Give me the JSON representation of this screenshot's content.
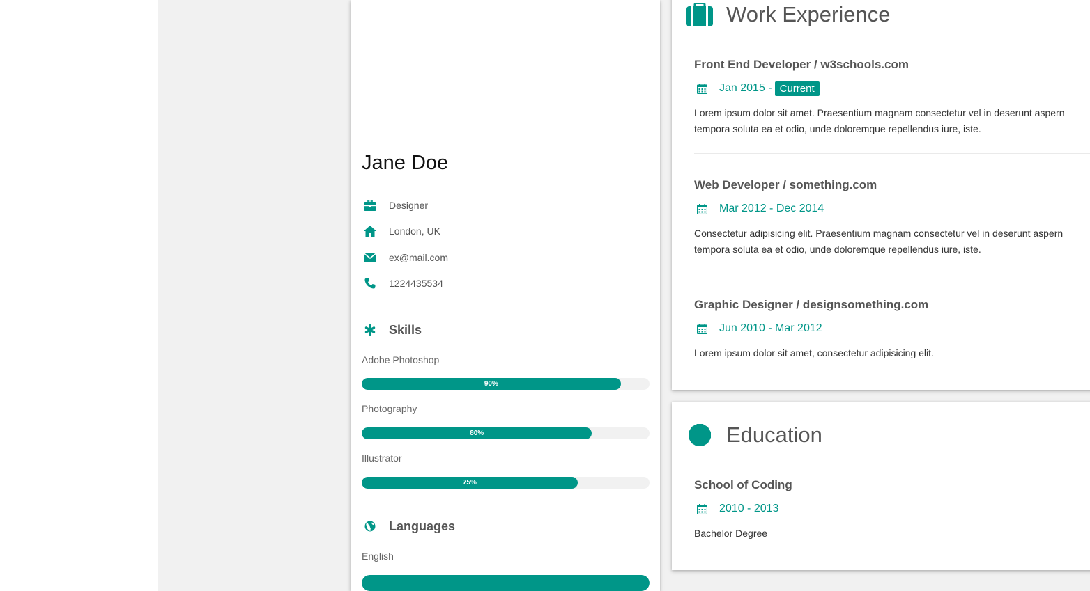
{
  "profile": {
    "name": "Jane Doe",
    "job": "Designer",
    "location": "London, UK",
    "email": "ex@mail.com",
    "phone": "1224435534"
  },
  "skills": {
    "heading": "Skills",
    "items": [
      {
        "label": "Adobe Photoshop",
        "percent_text": "90%",
        "level": 0.9
      },
      {
        "label": "Photography",
        "percent_text": "80%",
        "level": 0.8
      },
      {
        "label": "Illustrator",
        "percent_text": "75%",
        "level": 0.75
      }
    ]
  },
  "languages": {
    "heading": "Languages",
    "items": [
      {
        "label": "English",
        "level": 1.0
      }
    ]
  },
  "work": {
    "heading": "Work Experience",
    "jobs": [
      {
        "title": "Front End Developer / w3schools.com",
        "date": "Jan 2015 -",
        "badge": "Current",
        "desc_lines": [
          "Lorem ipsum dolor sit amet. Praesentium magnam consectetur vel in deserunt aspern",
          "tempora soluta ea et odio, unde doloremque repellendus iure, iste."
        ]
      },
      {
        "title": "Web Developer / something.com",
        "date": "Mar 2012 - Dec 2014",
        "desc_lines": [
          "Consectetur adipisicing elit. Praesentium magnam consectetur vel in deserunt aspern",
          "tempora soluta ea et odio, unde doloremque repellendus iure, iste."
        ]
      },
      {
        "title": "Graphic Designer / designsomething.com",
        "date": "Jun 2010 - Mar 2012",
        "desc_lines": [
          "Lorem ipsum dolor sit amet, consectetur adipisicing elit."
        ]
      }
    ]
  },
  "education": {
    "heading": "Education",
    "items": [
      {
        "title": "School of Coding",
        "date": "2010 - 2013",
        "desc": "Bachelor Degree"
      }
    ]
  },
  "colors": {
    "accent": "#009688",
    "page_bg": "#f1f1f1"
  },
  "icons": [
    "briefcase-icon",
    "home-icon",
    "envelope-icon",
    "phone-icon",
    "asterisk-icon",
    "globe-icon",
    "suitcase-icon",
    "certificate-icon",
    "calendar-icon"
  ]
}
